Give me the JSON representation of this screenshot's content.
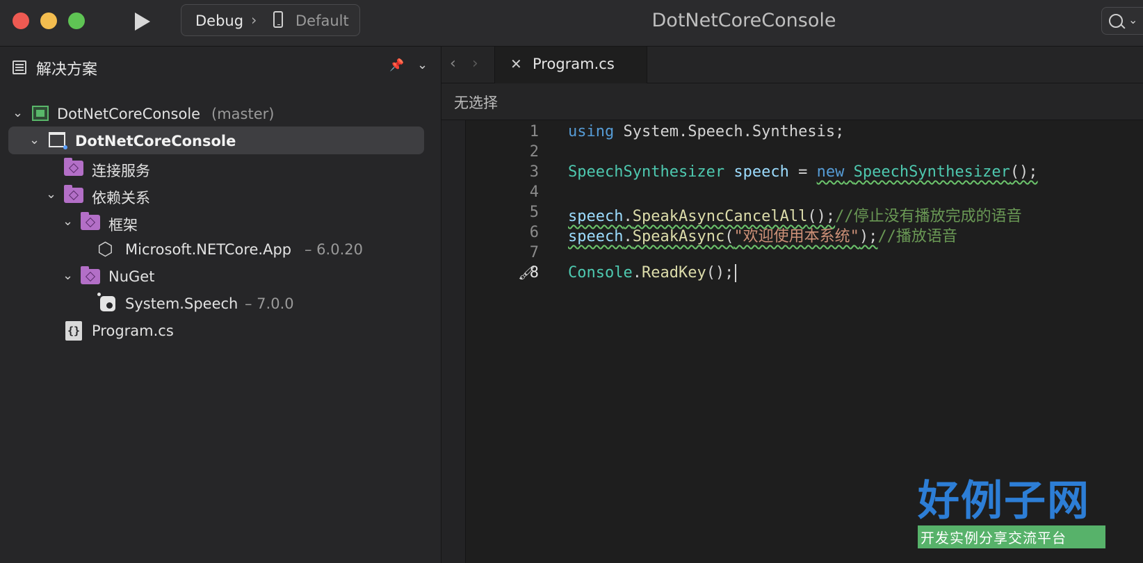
{
  "window": {
    "title": "DotNetCoreConsole"
  },
  "toolbar": {
    "config": "Debug",
    "separator": "›",
    "device": "Default",
    "search_chevron": "⌄"
  },
  "sidebar": {
    "title": "解决方案",
    "tree": [
      {
        "label": "DotNetCoreConsole",
        "suffix": "(master)"
      },
      {
        "label": "DotNetCoreConsole"
      },
      {
        "label": "连接服务"
      },
      {
        "label": "依赖关系"
      },
      {
        "label": "框架"
      },
      {
        "label": "Microsoft.NETCore.App",
        "suffix": "– 6.0.20"
      },
      {
        "label": "NuGet"
      },
      {
        "label": "System.Speech",
        "suffix": "– 7.0.0"
      },
      {
        "label": "Program.cs"
      }
    ]
  },
  "editor": {
    "tab_label": "Program.cs",
    "selector": "无选择",
    "line_numbers": [
      "1",
      "2",
      "3",
      "4",
      "5",
      "6",
      "7",
      "8"
    ],
    "lines": {
      "l1": {
        "kw": "using",
        "rest": " System.Speech.Synthesis;"
      },
      "l3": {
        "type1": "SpeechSynthesizer",
        "var": " speech",
        "op": " = ",
        "kw": "new",
        "sp": " ",
        "type2": "SpeechSynthesizer",
        "tail": "();"
      },
      "l5": {
        "var": "speech",
        "dot": ".",
        "fn": "SpeakAsyncCancelAll",
        "paren": "();",
        "comment": "//停止没有播放完成的语音"
      },
      "l6": {
        "var": "speech",
        "dot": ".",
        "fn": "SpeakAsync",
        "open": "(",
        "str": "\"欢迎使用本系统\"",
        "close": ");",
        "comment": "//播放语音"
      },
      "l8": {
        "type": "Console",
        "dot": ".",
        "fn": "ReadKey",
        "tail": "();"
      }
    }
  },
  "watermark": {
    "big": "好例子网",
    "small": "开发实例分享交流平台"
  }
}
